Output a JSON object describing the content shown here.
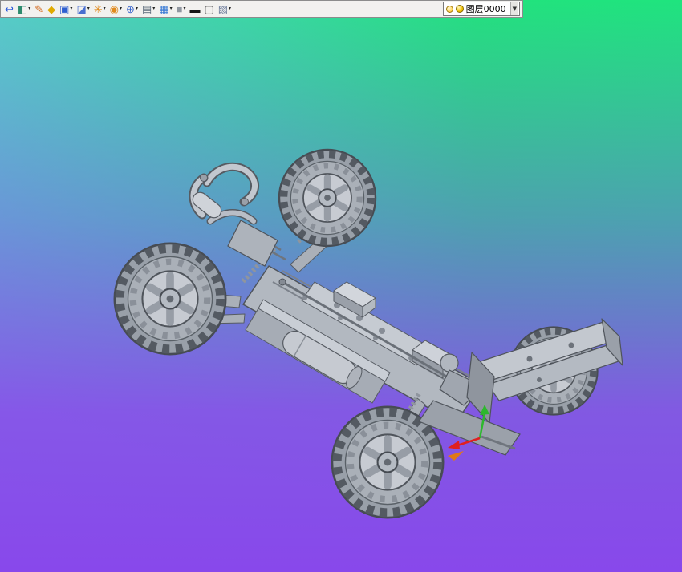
{
  "toolbar": {
    "dropdown_arrow": "▾",
    "items": [
      {
        "name": "exit-sketch",
        "glyph": "↩",
        "has_dropdown": false
      },
      {
        "name": "display-mode",
        "glyph": "◧",
        "has_dropdown": true
      },
      {
        "name": "sketch-pencil",
        "glyph": "✎",
        "has_dropdown": false
      },
      {
        "name": "iso-view",
        "glyph": "◆",
        "has_dropdown": false
      },
      {
        "name": "view-cube",
        "glyph": "▣",
        "has_dropdown": true
      },
      {
        "name": "solid-display",
        "glyph": "◪",
        "has_dropdown": true
      },
      {
        "name": "render-wheel",
        "glyph": "✳",
        "has_dropdown": true
      },
      {
        "name": "material-sphere",
        "glyph": "◉",
        "has_dropdown": true
      },
      {
        "name": "rotate-view",
        "glyph": "⊕",
        "has_dropdown": true
      },
      {
        "name": "screen-display",
        "glyph": "▤",
        "has_dropdown": true
      },
      {
        "name": "grid-snap",
        "glyph": "▦",
        "has_dropdown": true
      },
      {
        "name": "shaded-cube",
        "glyph": "■",
        "has_dropdown": true
      },
      {
        "name": "line-width",
        "glyph": "▬",
        "has_dropdown": false
      },
      {
        "name": "bg-color",
        "glyph": "▢",
        "has_dropdown": false
      },
      {
        "name": "layers",
        "glyph": "▧",
        "has_dropdown": true
      }
    ],
    "layer_combo": {
      "value": "图层0000",
      "arrow": "▼"
    }
  },
  "viewport": {
    "background_top_left": "#55cfc6",
    "background_top_right": "#1fe47e",
    "background_bottom": "#8848eb",
    "model_part_color": "#b4bac2",
    "model_outline_color": "#4f545b",
    "triad_x_axis_color": "#e02020",
    "triad_z_axis_color": "#2db82d",
    "marker_color": "#e07818"
  }
}
